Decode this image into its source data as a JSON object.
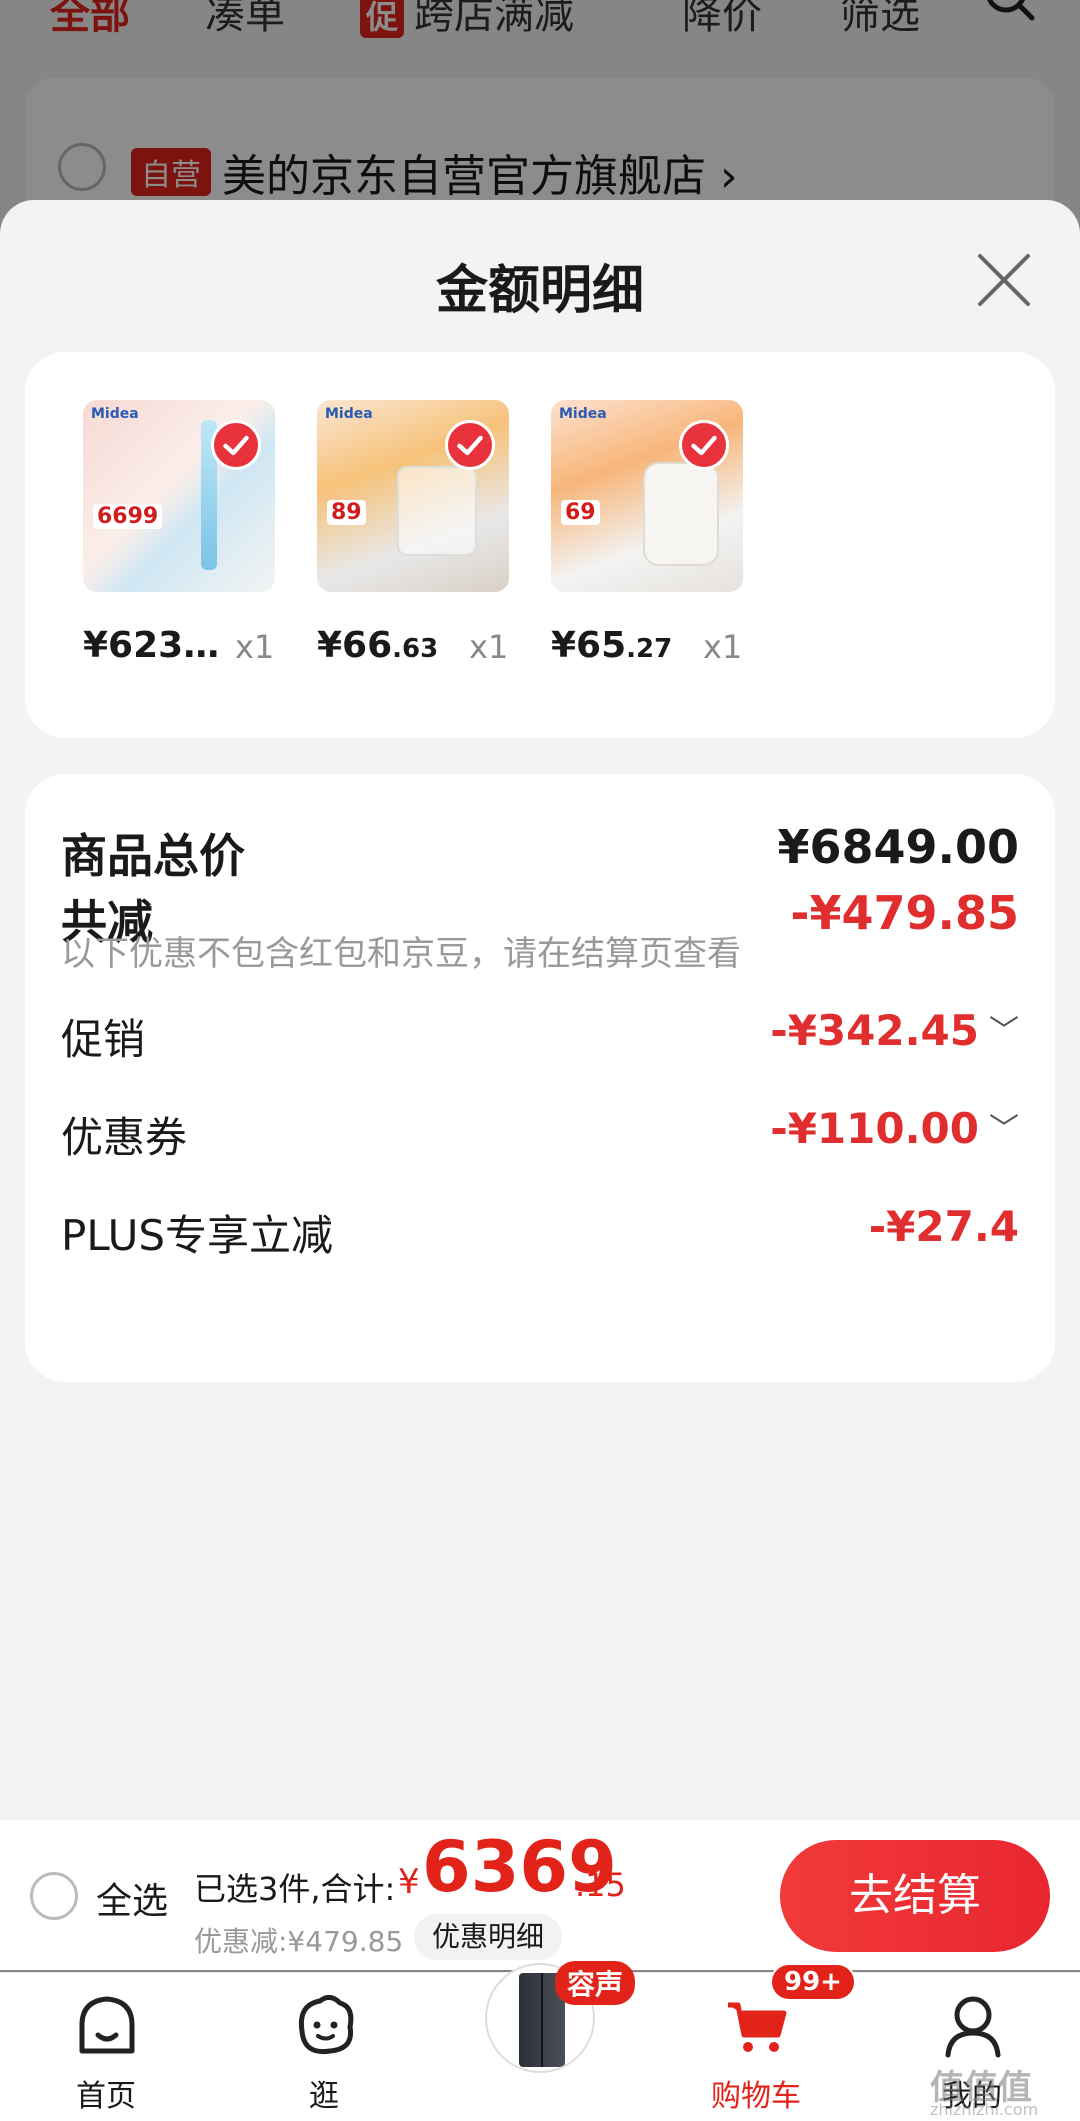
{
  "background": {
    "tabs": [
      {
        "label": "全部",
        "active": true
      },
      {
        "label": "凑单"
      },
      {
        "label": "跨店满减",
        "badge": "促"
      },
      {
        "label": "降价"
      },
      {
        "label": "筛选"
      }
    ],
    "self_tag": "自营",
    "store_name": "美的京东自营官方旗舰店",
    "store_chevron": "›"
  },
  "sheet": {
    "title": "金额明细",
    "products": [
      {
        "price_main": "¥623…",
        "price_dec": "",
        "qty": "x1",
        "brand": "Midea",
        "promo_price": "6699"
      },
      {
        "price_main": "¥66",
        "price_dec": ".63",
        "qty": "x1",
        "brand": "Midea",
        "promo_price": "89"
      },
      {
        "price_main": "¥65",
        "price_dec": ".27",
        "qty": "x1",
        "brand": "Midea",
        "promo_price": "69"
      }
    ],
    "total_label": "商品总价",
    "total_value": "¥6849.00",
    "reduce_label": "共减",
    "reduce_value": "-¥479.85",
    "reduce_note": "以下优惠不包含红包和京豆，请在结算页查看",
    "promo_label": "促销",
    "promo_value": "-¥342.45",
    "coupon_label": "优惠券",
    "coupon_value": "-¥110.00",
    "plus_label": "PLUS专享立减",
    "plus_value": "-¥27.4",
    "chevron": "﹀"
  },
  "checkout": {
    "select_all": "全选",
    "summary": "已选3件,合计:",
    "currency": "¥",
    "total_int": "6369",
    "total_dec": ".15",
    "discount": "优惠减:¥479.85",
    "detail_button": "优惠明细",
    "pay_button": "去结算"
  },
  "nav": {
    "items": [
      {
        "label": "首页"
      },
      {
        "label": "逛"
      },
      {
        "label": ""
      },
      {
        "label": "购物车",
        "active": true
      },
      {
        "label": "我的"
      }
    ],
    "center_tag": "容声",
    "cart_badge": "99+"
  },
  "watermark": "值值值",
  "watermark_sub": "zhizhizhi.com",
  "colors": {
    "accent": "#e2231a",
    "text": "#1a1a1a",
    "muted": "#999999"
  }
}
